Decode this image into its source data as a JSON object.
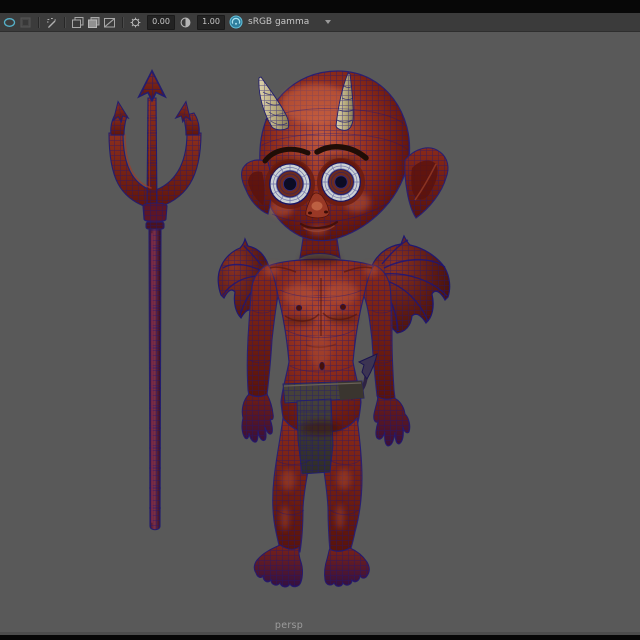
{
  "window": {
    "background_color": "#595959",
    "chrome_color": "#3b3b3b",
    "strip_color": "#070707"
  },
  "toolbar": {
    "exposure": {
      "value": "0.00",
      "icon": "exposure-icon"
    },
    "gamma": {
      "value": "1.00",
      "icon": "gamma-icon"
    },
    "view_transform": {
      "label": "sRGB gamma",
      "icon": "color-management-icon",
      "dropdown": "chevron-down-icon"
    },
    "left_icons": [
      "isolate-select-icon",
      "shaded-mode-icon",
      "grease-pencil-icon",
      "frame-stack-icon",
      "frame-stack-filled-icon",
      "image-plane-icon"
    ],
    "accent_color": "#55b0c8",
    "icon_color": "#b0b0b0",
    "field_bg": "#232323"
  },
  "viewport": {
    "camera_label": "persp",
    "label_color": "#9c9c9c"
  },
  "scene": {
    "objects": [
      {
        "name": "trident-prop",
        "base_color": "#6b1d12",
        "shaft_color": "#5a1a32",
        "wire_color": "#1c1578"
      },
      {
        "name": "devil-character",
        "skin_color": "#8a2a1a",
        "horn_color": "#d5c9a2",
        "wing_color": "#5c1a12",
        "cloth_color": "#46413a",
        "eye_white": "#ccd2d4",
        "iris_color": "#6d2b1e",
        "pupil_color": "#0c0c24",
        "wire_color": "#1c1578"
      }
    ]
  }
}
